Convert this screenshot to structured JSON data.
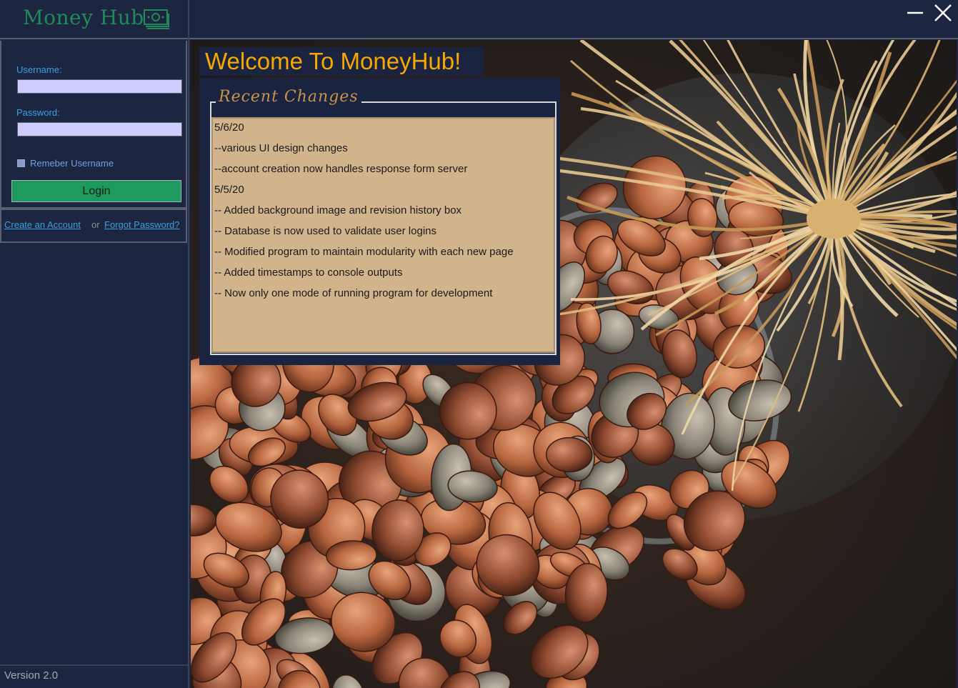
{
  "app": {
    "logo_text": "Money Hub",
    "logo_icon": "banknote-icon",
    "brand_color": "#1f8a5a",
    "accent_color": "#f5a800"
  },
  "login": {
    "username_label": "Username:",
    "username_value": "",
    "password_label": "Password:",
    "password_value": "",
    "remember_label": "Remeber Username",
    "login_button": "Login"
  },
  "links": {
    "create_account": "Create an Account",
    "or_text": "or",
    "forgot_password": "Forgot Password?"
  },
  "footer": {
    "version": "Version 2.0"
  },
  "window_controls": {
    "minimize_icon": "minimize-icon",
    "close_icon": "close-icon"
  },
  "main": {
    "background_image": "coins-jar-photo",
    "welcome": "Welcome To MoneyHub!",
    "changes_title": "Recent  Changes",
    "changes": [
      "5/6/20",
      "--various UI design changes",
      "--account creation now handles response form server",
      "5/5/20",
      "-- Added background image and revision history box",
      "-- Database is now used to validate user logins",
      "-- Modified program to maintain modularity with each new page",
      "-- Added timestamps to console outputs",
      "-- Now only one mode of running program for development"
    ]
  }
}
